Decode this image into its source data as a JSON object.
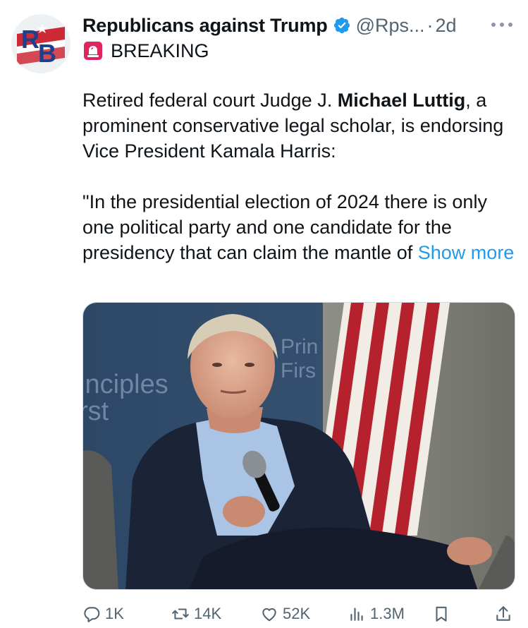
{
  "tweet": {
    "author_name": "Republicans against Trump",
    "handle": "@Rps...",
    "separator": "·",
    "time": "2d",
    "avatar_letters": "RB",
    "label": "BREAKING",
    "text": {
      "p1_before": "Retired federal court Judge J. ",
      "p1_bold": "Michael Luttig",
      "p1_after": ", a prominent conservative legal scholar, is endorsing Vice President Kamala Harris:",
      "p2": "\"In the presidential election of 2024 there is only one political party and one candidate for the presidency that can claim the mantle of",
      "show_more": "Show more"
    },
    "media": {
      "backdrop_text_left": [
        "inciples",
        "rst"
      ],
      "backdrop_text_right": [
        "Prin",
        "Firs"
      ]
    }
  },
  "actions": {
    "replies": "1K",
    "reposts": "14K",
    "likes": "52K",
    "views": "1.3M"
  },
  "colors": {
    "accent": "#1d9bf0",
    "secondary_text": "#536471",
    "verified": "#1d9bf0"
  },
  "icons": [
    "avatar-rb-logo",
    "verified-badge-icon",
    "more-icon",
    "siren-icon",
    "reply-icon",
    "repost-icon",
    "like-icon",
    "views-icon",
    "bookmark-icon",
    "share-icon"
  ]
}
